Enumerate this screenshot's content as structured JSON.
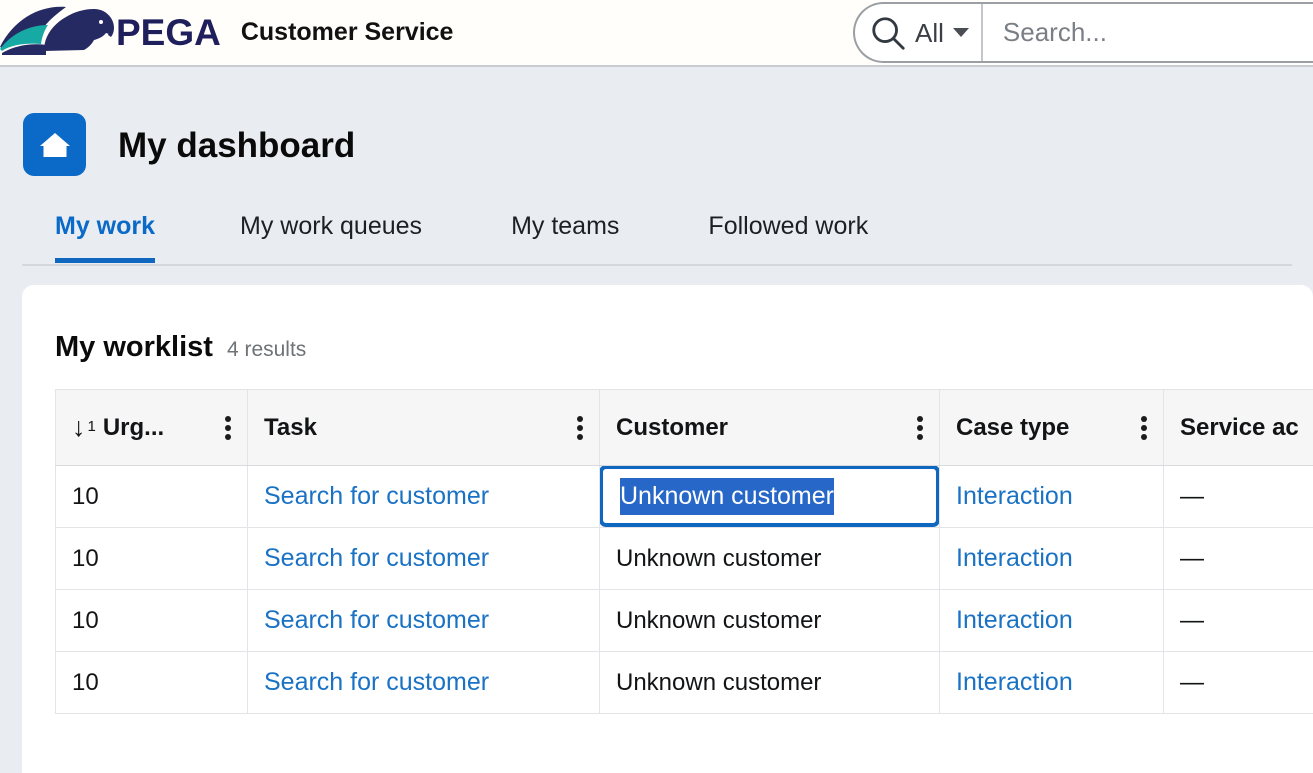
{
  "appbar": {
    "logo_icon": "pega-horse-logo",
    "brand_word": "PEGA",
    "app_title": "Customer Service",
    "search": {
      "search_icon": "search-icon",
      "scope_label": "All",
      "scope_caret_icon": "chevron-down-icon",
      "placeholder": "Search...",
      "value": ""
    }
  },
  "page": {
    "home_icon": "home-icon",
    "title": "My dashboard"
  },
  "tabs": [
    {
      "label": "My work",
      "active": true
    },
    {
      "label": "My work queues",
      "active": false
    },
    {
      "label": "My teams",
      "active": false
    },
    {
      "label": "Followed work",
      "active": false
    }
  ],
  "worklist": {
    "title": "My worklist",
    "result_count": "4 results",
    "columns": [
      {
        "label": "Urg...",
        "full_label": "Urgency",
        "sort_icon": "sort-descending-arrow-icon",
        "sort_rank": "1",
        "menu_icon": "kebab-menu-icon"
      },
      {
        "label": "Task",
        "menu_icon": "kebab-menu-icon"
      },
      {
        "label": "Customer",
        "menu_icon": "kebab-menu-icon"
      },
      {
        "label": "Case type",
        "menu_icon": "kebab-menu-icon"
      },
      {
        "label": "Service ac",
        "full_label": "Service activity",
        "menu_icon": "kebab-menu-icon"
      }
    ],
    "rows": [
      {
        "urgency": "10",
        "task": "Search for customer",
        "customer": "Unknown customer",
        "case_type": "Interaction",
        "service_activity": "—",
        "customer_selected": true
      },
      {
        "urgency": "10",
        "task": "Search for customer",
        "customer": "Unknown customer",
        "case_type": "Interaction",
        "service_activity": "—",
        "customer_selected": false
      },
      {
        "urgency": "10",
        "task": "Search for customer",
        "customer": "Unknown customer",
        "case_type": "Interaction",
        "service_activity": "—",
        "customer_selected": false
      },
      {
        "urgency": "10",
        "task": "Search for customer",
        "customer": "Unknown customer",
        "case_type": "Interaction",
        "service_activity": "—",
        "customer_selected": false
      }
    ]
  },
  "colors": {
    "brand_navy": "#1f1f5c",
    "brand_teal": "#19a8a0",
    "accent_blue": "#0b69c7",
    "link_blue": "#1a72c4",
    "selection_blue": "#2767c8",
    "page_background": "#e9edf2"
  }
}
